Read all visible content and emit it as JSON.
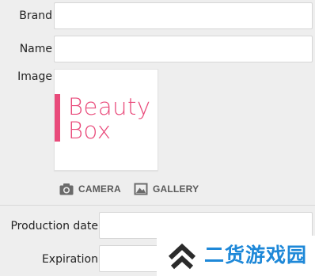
{
  "form": {
    "brand": {
      "label": "Brand",
      "value": ""
    },
    "name": {
      "label": "Name",
      "value": ""
    },
    "image": {
      "label": "Image",
      "logo_line1": "Beauty",
      "logo_line2": "Box",
      "logo_color": "#e94b7b"
    },
    "camera_button": {
      "label": "CAMERA",
      "icon": "camera-icon"
    },
    "gallery_button": {
      "label": "GALLERY",
      "icon": "gallery-icon"
    },
    "production_date": {
      "label": "Production date",
      "value": ""
    },
    "expiration": {
      "label": "Expiration",
      "value": ""
    }
  },
  "watermark": {
    "text": "二货游戏园",
    "icon": "double-chevron-up-logo",
    "color": "#1e88d8"
  },
  "colors": {
    "background": "#eeeeee",
    "accent": "#e94b7b"
  }
}
